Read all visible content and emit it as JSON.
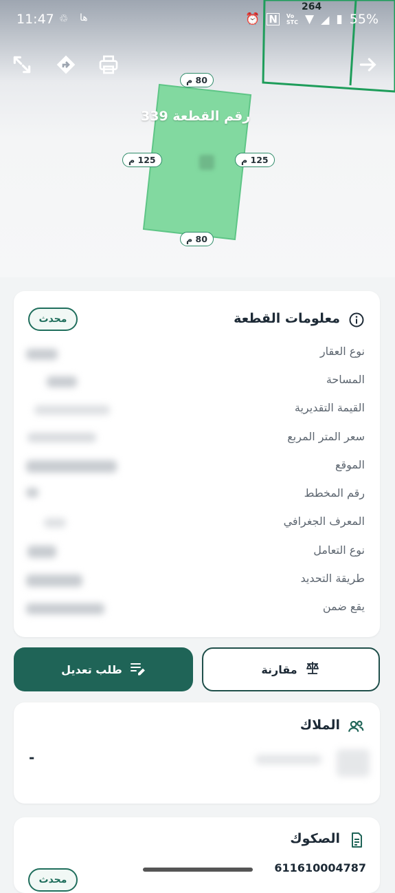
{
  "status_bar": {
    "time": "11:47",
    "battery": "55%",
    "carrier": "Vo\nSTC"
  },
  "map": {
    "title": "رقم القطعة 339",
    "neighbor_plot": "264",
    "dimensions": {
      "top": "80 م",
      "bottom": "80 م",
      "left": "125 م",
      "right": "125 م"
    },
    "plot_fill": "#82d9a0",
    "plot_stroke": "#5ec586"
  },
  "plot_info": {
    "title": "معلومات القطعة",
    "badge": "محدث",
    "rows": [
      "نوع العقار",
      "المساحة",
      "القيمة التقديرية",
      "سعر المتر المربع",
      "الموقع",
      "رقم المخطط",
      "المعرف الجغرافي",
      "نوع التعامل",
      "طريقة التحديد",
      "يقع ضمن"
    ]
  },
  "actions": {
    "compare": "مقارنة",
    "edit_request": "طلب تعديل"
  },
  "owners": {
    "title": "الملاك",
    "dash": "-"
  },
  "deeds": {
    "title": "الصكوك",
    "badge": "محدث",
    "deed_number": "611610004787"
  },
  "colors": {
    "primary": "#1f6457",
    "accent_green": "#2e8b68",
    "card_bg": "#ffffff"
  }
}
